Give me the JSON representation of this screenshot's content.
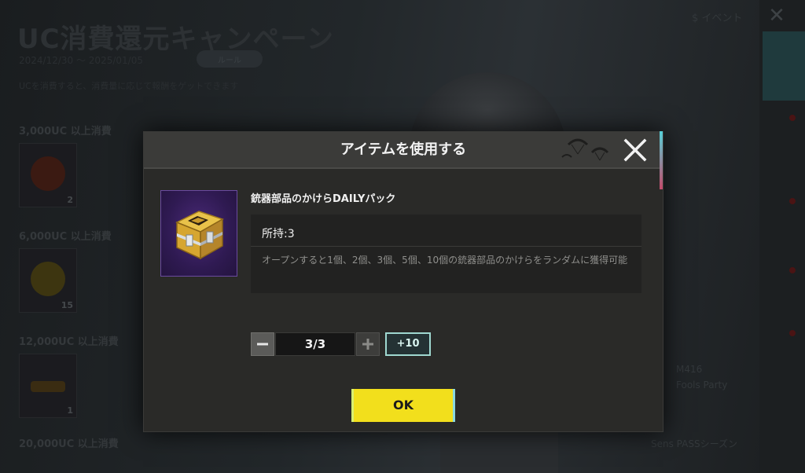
{
  "background": {
    "event_title": "UC消費還元キャンペーン",
    "event_subtitle": "2024/12/30 ～ 2025/01/05",
    "pill_label": "ルール",
    "description": "UCを消費すると、消費量に応じて報酬をゲットできます",
    "rewards": [
      {
        "label": "3,000UC 以上消費",
        "count": "2"
      },
      {
        "label": "6,000UC 以上消費",
        "count": "15"
      },
      {
        "label": "12,000UC 以上消費",
        "count": "1"
      },
      {
        "label": "20,000UC 以上消費",
        "count": ""
      }
    ],
    "top_right_label": "$ イベント",
    "bottom_right_lines": [
      "M416",
      "Fools Party"
    ],
    "bottom_right_line2": "Sens PASSシーズン"
  },
  "dialog": {
    "title": "アイテムを使用する",
    "item_name": "銃器部品のかけらDAILYパック",
    "owned_label": "所持:3",
    "description": "オープンすると1個、2個、3個、5個、10個の銃器部品のかけらをランダムに獲得可能",
    "quantity_display": "3/3",
    "plus10_label": "+10",
    "ok_label": "OK",
    "close_icon": "close-icon",
    "minus_icon": "minus-icon",
    "plus_icon": "plus-icon",
    "item_icon": "golden-crate-icon"
  },
  "colors": {
    "ok_button": "#f2df1c",
    "plus10_border": "#9fd8d0",
    "item_icon_bg": "#2f1a52"
  }
}
